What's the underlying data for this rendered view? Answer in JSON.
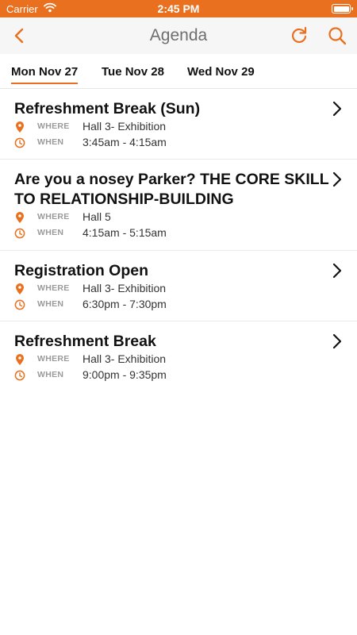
{
  "status_bar": {
    "carrier": "Carrier",
    "time": "2:45 PM"
  },
  "nav": {
    "title": "Agenda",
    "back_icon": "chevron-left-icon",
    "refresh_icon": "refresh-icon",
    "search_icon": "search-icon",
    "accent_color": "#e8701e"
  },
  "tabs": [
    {
      "label": "Mon Nov 27",
      "active": true
    },
    {
      "label": "Tue Nov 28",
      "active": false
    },
    {
      "label": "Wed Nov 29",
      "active": false
    }
  ],
  "meta_labels": {
    "where": "WHERE",
    "when": "WHEN"
  },
  "sessions": [
    {
      "title": "Refreshment Break (Sun)",
      "where": "Hall 3- Exhibition",
      "when": "3:45am - 4:15am"
    },
    {
      "title": "Are you a nosey Parker? THE CORE SKILL TO RELATIONSHIP-BUILDING",
      "where": "Hall 5",
      "when": "4:15am - 5:15am"
    },
    {
      "title": "Registration Open",
      "where": "Hall 3- Exhibition",
      "when": "6:30pm - 7:30pm"
    },
    {
      "title": "Refreshment Break",
      "where": "Hall 3- Exhibition",
      "when": "9:00pm - 9:35pm"
    }
  ]
}
